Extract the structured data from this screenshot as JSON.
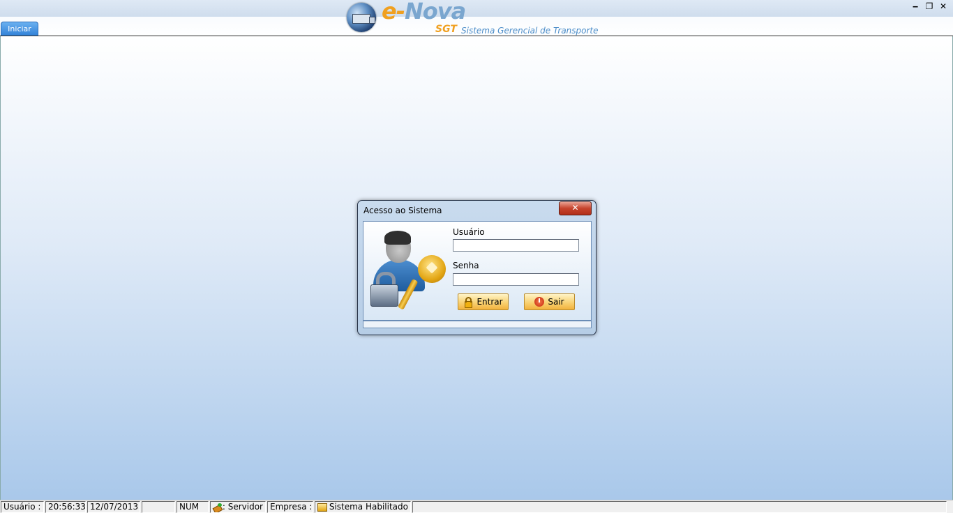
{
  "app": {
    "logo_prefix": "e-",
    "logo_name": "Nova",
    "logo_sgt": "SGT",
    "logo_subtitle": "Sistema Gerencial de Transporte",
    "start_tab": "Iniciar"
  },
  "window_controls": {
    "minimize": "‒",
    "restore": "❐",
    "close": "✕"
  },
  "dialog": {
    "title": "Acesso ao Sistema",
    "close_glyph": "✕",
    "user_label": "Usuário",
    "user_value": "",
    "password_label": "Senha",
    "password_value": "",
    "enter_button": "Entrar",
    "exit_button": "Sair"
  },
  "statusbar": {
    "user": "Usuário :",
    "time": "20:56:33",
    "date": "12/07/2013",
    "empty": "",
    "num": "NUM",
    "server": ": Servidor",
    "company": "Empresa :",
    "system": "Sistema Habilitado",
    "rest": ""
  },
  "icons": [
    "globe-truck-logo",
    "person-icon",
    "padlock-icon",
    "key-icon",
    "lock-open-icon",
    "power-icon",
    "server-icon",
    "system-icon"
  ],
  "colors": {
    "accent_orange": "#f0a020",
    "logo_blue": "#7aa6cf",
    "start_tab_blue": "#2f7fd6",
    "close_red": "#c6432c"
  }
}
